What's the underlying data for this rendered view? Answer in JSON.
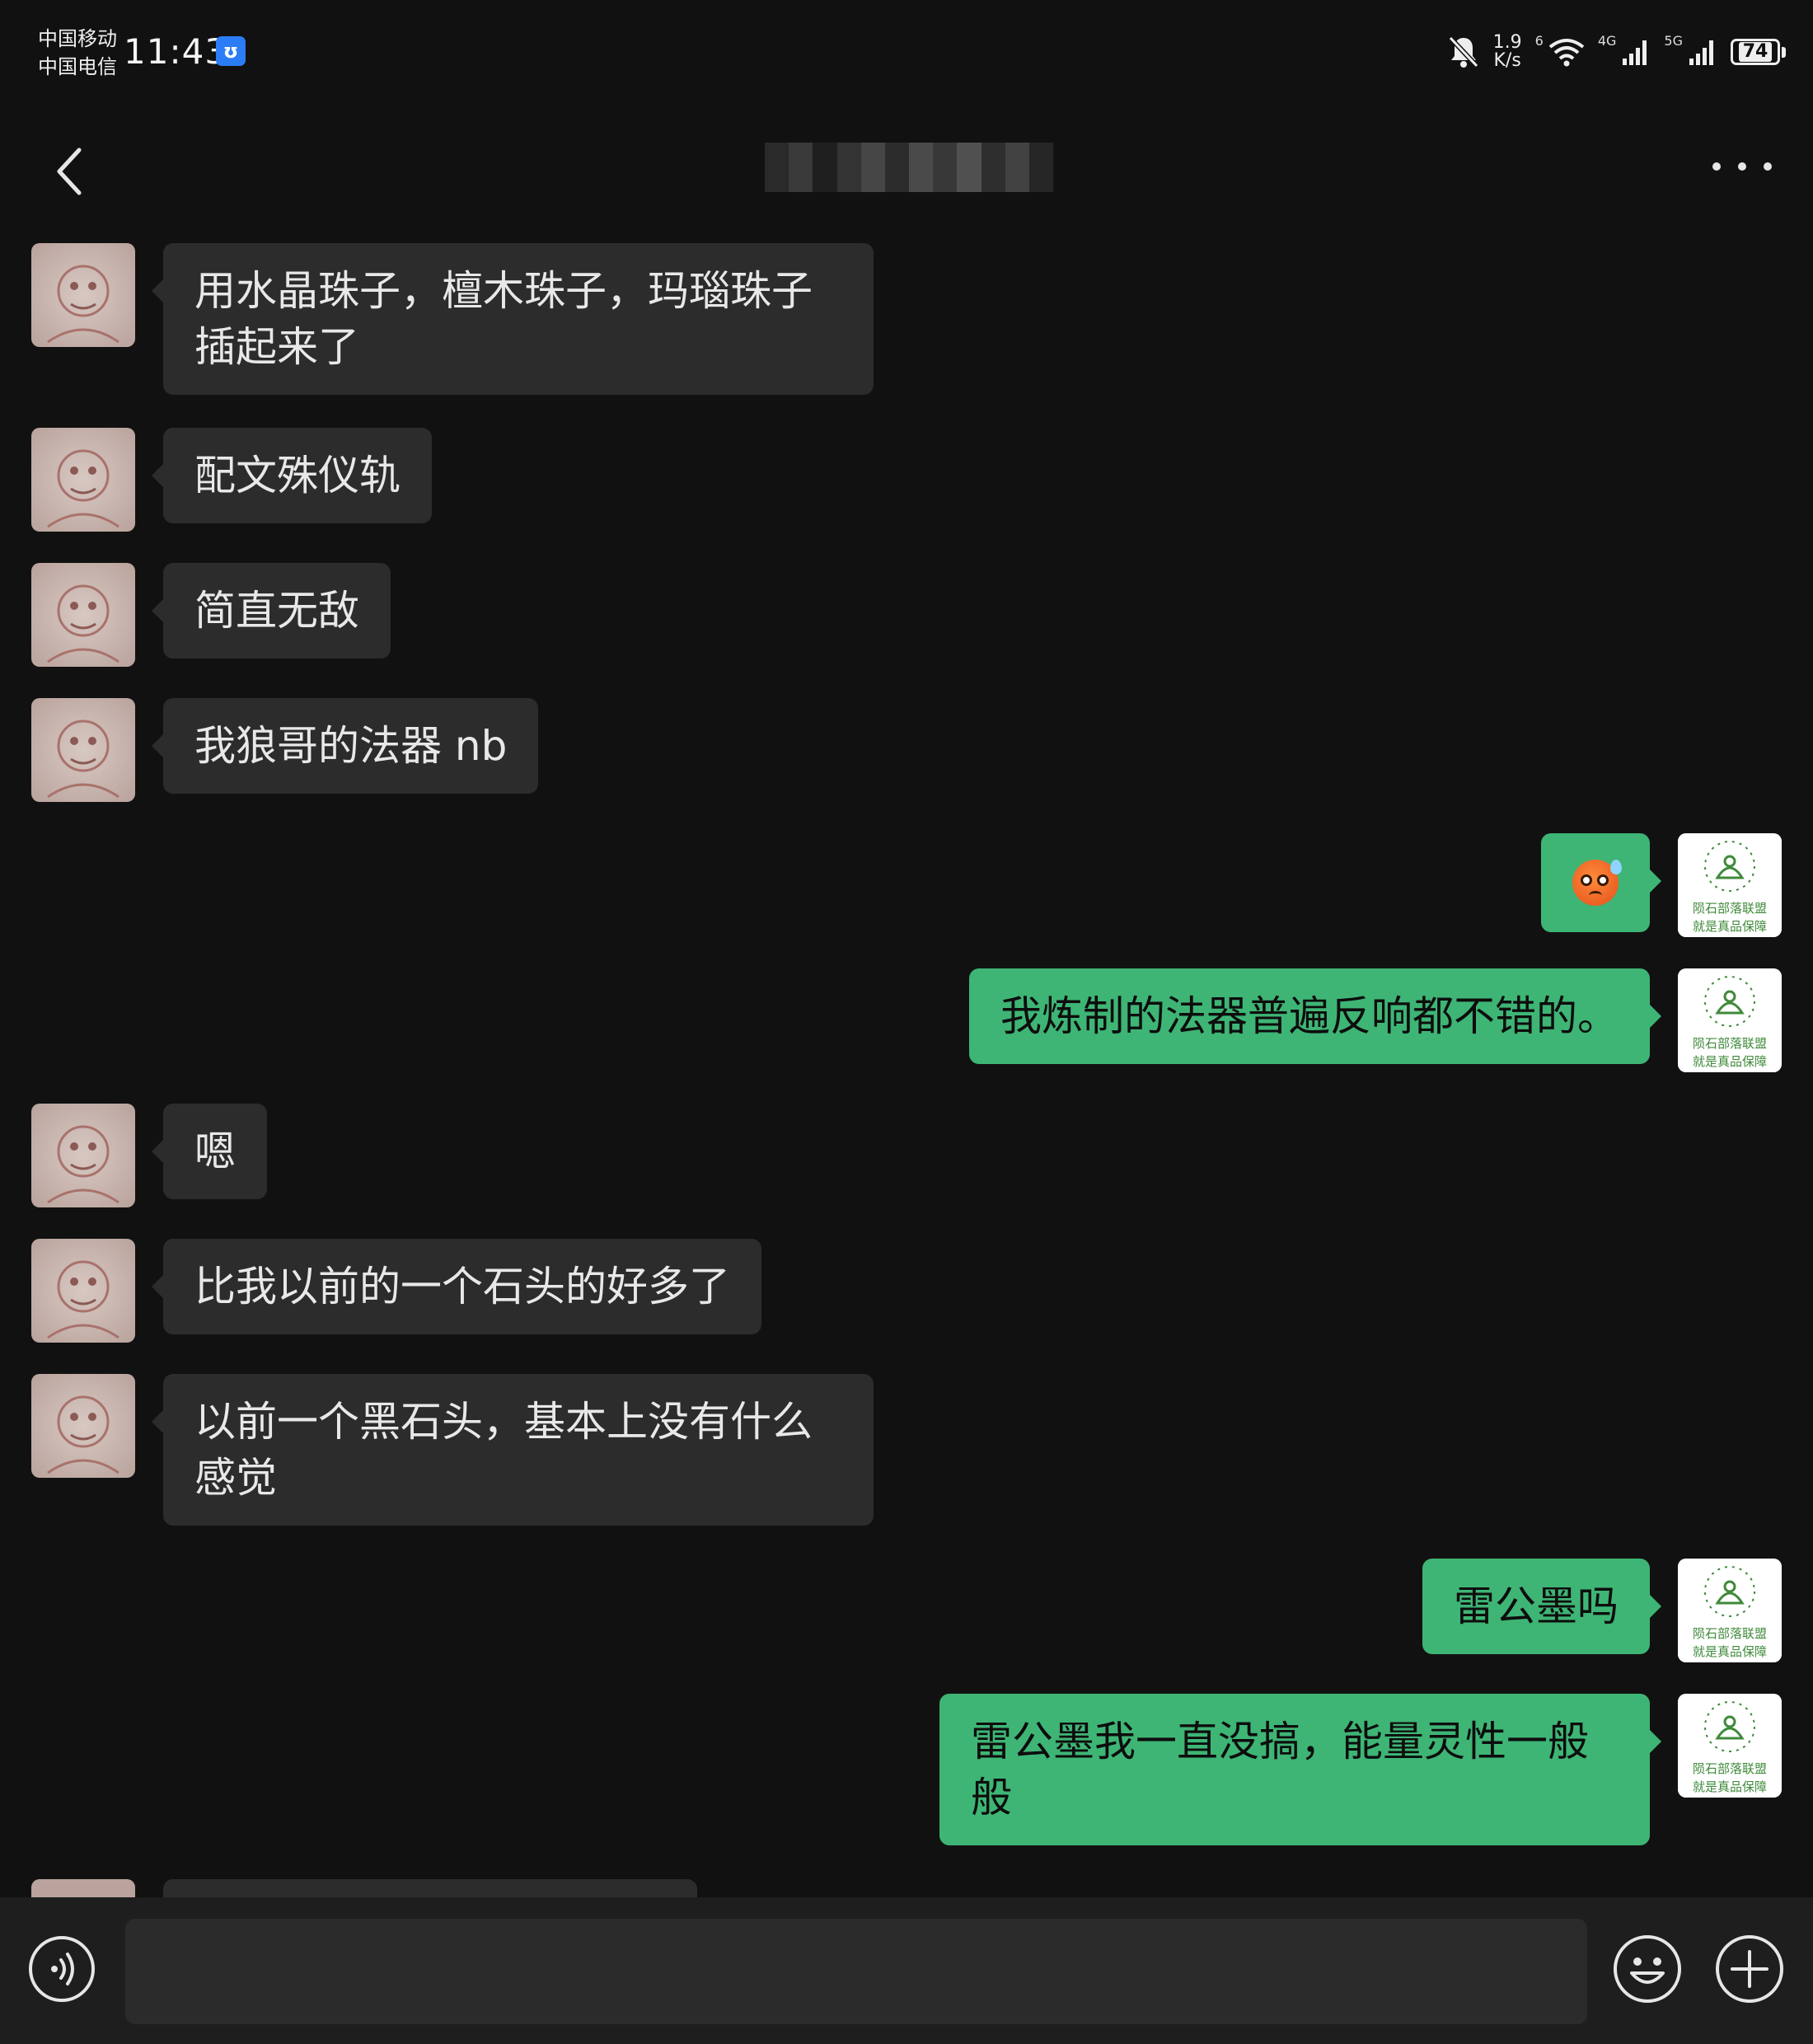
{
  "status_bar": {
    "carrier_1": "中国移动",
    "carrier_2": "中国电信",
    "time": "11:43",
    "app_badge": "ʊ",
    "net_speed_value": "1.9",
    "net_speed_unit": "K/s",
    "wifi_tag": "6",
    "signal_1_tag": "4G",
    "signal_2_tag": "5G",
    "battery": "74"
  },
  "header": {
    "title": ""
  },
  "messages": [
    {
      "side": "left",
      "text": "用水晶珠子，檀木珠子，玛瑙珠子插起来了"
    },
    {
      "side": "left",
      "text": "配文殊仪轨"
    },
    {
      "side": "left",
      "text": "简直无敌"
    },
    {
      "side": "left",
      "text": "我狼哥的法器 nb"
    },
    {
      "side": "right",
      "emoji": "anxious-sweat-face"
    },
    {
      "side": "right",
      "text": "我炼制的法器普遍反响都不错的。"
    },
    {
      "side": "left",
      "text": "嗯"
    },
    {
      "side": "left",
      "text": "比我以前的一个石头的好多了"
    },
    {
      "side": "left",
      "text": "以前一个黑石头，基本上没有什么感觉"
    },
    {
      "side": "right",
      "text": "雷公墨吗"
    },
    {
      "side": "right",
      "text": "雷公墨我一直没搞，能量灵性一般般"
    }
  ],
  "self_avatar": {
    "caption_line_1": "陨石部落联盟",
    "caption_line_2": "就是真品保障"
  },
  "input_bar": {
    "placeholder": ""
  },
  "icons": {
    "back": "chevron-left-icon",
    "more": "more-dots-icon",
    "voice": "voice-icon",
    "emoji": "smiley-icon",
    "plus": "plus-icon",
    "mute": "bell-off-icon",
    "wifi": "wifi-icon",
    "signal": "signal-bars-icon",
    "battery": "battery-icon"
  },
  "colors": {
    "background": "#111111",
    "incoming_bubble": "#2c2c2c",
    "outgoing_bubble": "#3eb575",
    "self_avatar_green": "#3f8a3a"
  }
}
